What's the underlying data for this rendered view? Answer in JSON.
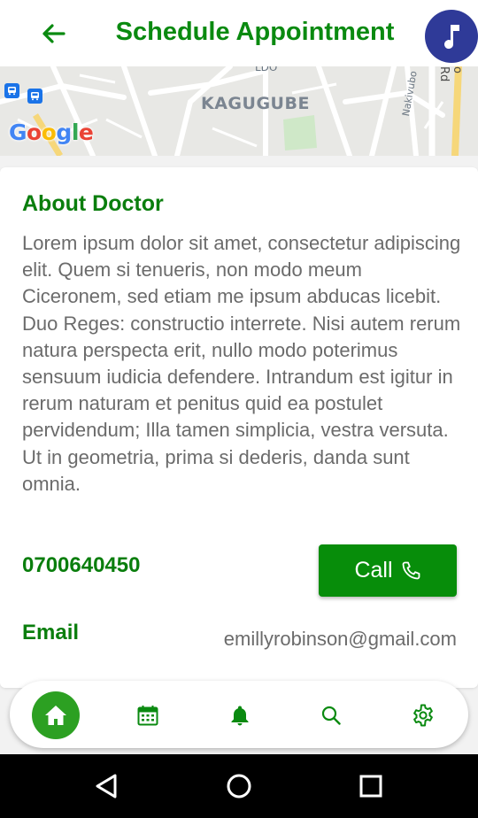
{
  "header": {
    "title": "Schedule Appointment",
    "back_icon": "arrow-left-icon",
    "music_icon": "music-note-icon"
  },
  "map": {
    "area_label": "KAGUGUBE",
    "road_label_1": "Nakivubo",
    "road_label_2": "o Rd",
    "partial_label": "LDO",
    "logo_letters": [
      "G",
      "o",
      "o",
      "g",
      "l",
      "e"
    ]
  },
  "about": {
    "heading": "About Doctor",
    "text": "Lorem ipsum dolor sit amet, consectetur adipiscing elit. Quem si tenueris, non modo meum Ciceronem, sed etiam me ipsum abducas licebit. Duo Reges: constructio interrete. Nisi autem rerum natura perspecta erit, nullo modo poterimus sensuum iudicia defendere. Intrandum est igitur in rerum naturam et penitus quid ea postulet pervidendum; Illa tamen simplicia, vestra versuta. Ut in geometria, prima si dederis, danda sunt omnia."
  },
  "contact": {
    "phone": "0700640450",
    "call_label": "Call",
    "call_icon": "phone-icon",
    "email_label": "Email",
    "email_value": "emillyrobinson@gmail.com"
  },
  "bottom_nav": {
    "items": [
      "home-icon",
      "calendar-icon",
      "bell-icon",
      "search-icon",
      "settings-icon"
    ],
    "active": "home"
  },
  "colors": {
    "primary_green": "#078d0a",
    "heading_green": "#0a7e0d",
    "fab_blue": "#2f3a98",
    "body_text": "#6b6b6b"
  }
}
